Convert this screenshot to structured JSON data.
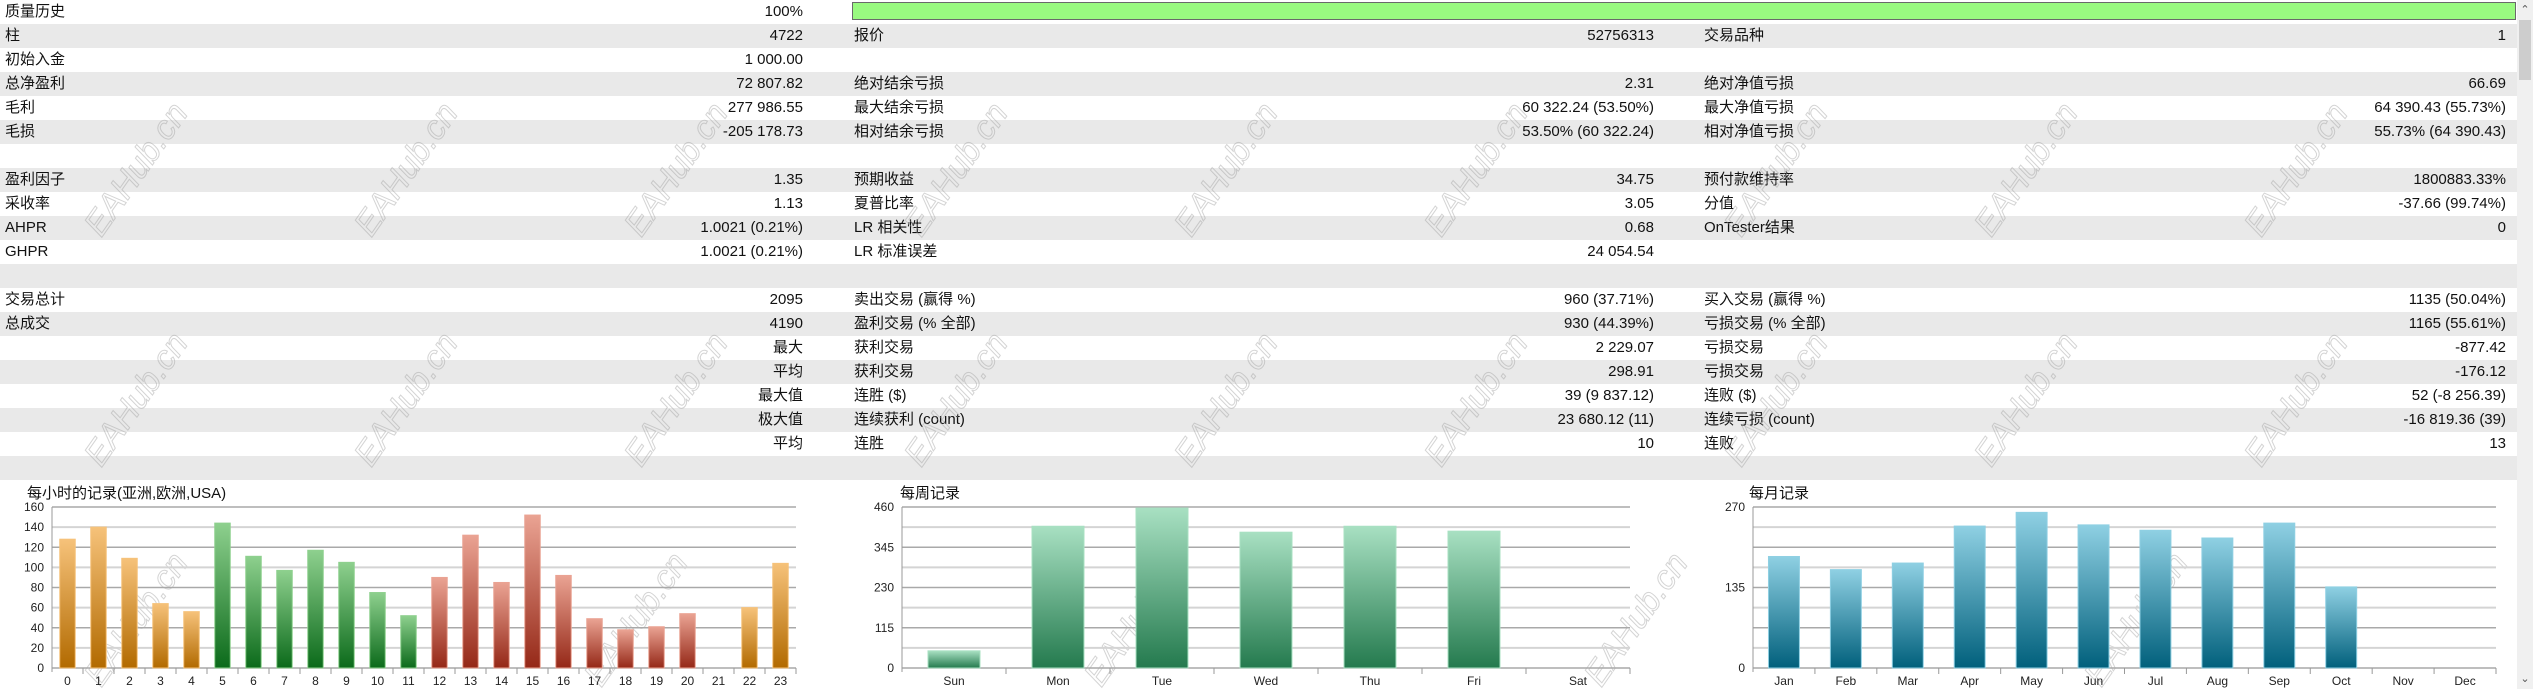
{
  "quality": {
    "label": "质量历史",
    "value": "100%",
    "fill": 1.0,
    "bar_color": "#99fa80"
  },
  "rows": [
    {
      "c1": [
        "柱",
        "4722"
      ],
      "c2": [
        "报价",
        "52756313"
      ],
      "c3": [
        "交易品种",
        "1"
      ]
    },
    {
      "c1": [
        "初始入金",
        "1 000.00"
      ],
      "c2": [
        "",
        ""
      ],
      "c3": [
        "",
        ""
      ]
    },
    {
      "c1": [
        "总净盈利",
        "72 807.82"
      ],
      "c2": [
        "绝对结余亏损",
        "2.31"
      ],
      "c3": [
        "绝对净值亏损",
        "66.69"
      ]
    },
    {
      "c1": [
        "毛利",
        "277 986.55"
      ],
      "c2": [
        "最大结余亏损",
        "60 322.24 (53.50%)"
      ],
      "c3": [
        "最大净值亏损",
        "64 390.43 (55.73%)"
      ]
    },
    {
      "c1": [
        "毛损",
        "-205 178.73"
      ],
      "c2": [
        "相对结余亏损",
        "53.50% (60 322.24)"
      ],
      "c3": [
        "相对净值亏损",
        "55.73% (64 390.43)"
      ]
    },
    {
      "c1": [
        "",
        ""
      ],
      "c2": [
        "",
        ""
      ],
      "c3": [
        "",
        ""
      ]
    },
    {
      "c1": [
        "盈利因子",
        "1.35"
      ],
      "c2": [
        "预期收益",
        "34.75"
      ],
      "c3": [
        "预付款维持率",
        "1800883.33%"
      ]
    },
    {
      "c1": [
        "采收率",
        "1.13"
      ],
      "c2": [
        "夏普比率",
        "3.05"
      ],
      "c3": [
        "分值",
        "-37.66 (99.74%)"
      ]
    },
    {
      "c1": [
        "AHPR",
        "1.0021 (0.21%)"
      ],
      "c2": [
        "LR 相关性",
        "0.68"
      ],
      "c3": [
        "OnTester结果",
        "0"
      ]
    },
    {
      "c1": [
        "GHPR",
        "1.0021 (0.21%)"
      ],
      "c2": [
        "LR 标准误差",
        "24 054.54"
      ],
      "c3": [
        "",
        ""
      ]
    },
    {
      "c1": [
        "",
        ""
      ],
      "c2": [
        "",
        ""
      ],
      "c3": [
        "",
        ""
      ]
    },
    {
      "c1": [
        "交易总计",
        "2095"
      ],
      "c2": [
        "卖出交易 (赢得 %)",
        "960 (37.71%)"
      ],
      "c3": [
        "买入交易 (赢得 %)",
        "1135 (50.04%)"
      ]
    },
    {
      "c1": [
        "总成交",
        "4190"
      ],
      "c2": [
        "盈利交易 (% 全部)",
        "930 (44.39%)"
      ],
      "c3": [
        "亏损交易 (% 全部)",
        "1165 (55.61%)"
      ]
    },
    {
      "c1": [
        "",
        "最大"
      ],
      "c2": [
        "获利交易",
        "2 229.07"
      ],
      "c3": [
        "亏损交易",
        "-877.42"
      ]
    },
    {
      "c1": [
        "",
        "平均"
      ],
      "c2": [
        "获利交易",
        "298.91"
      ],
      "c3": [
        "亏损交易",
        "-176.12"
      ]
    },
    {
      "c1": [
        "",
        "最大值"
      ],
      "c2": [
        "连胜 ($)",
        "39 (9 837.12)"
      ],
      "c3": [
        "连败 ($)",
        "52 (-8 256.39)"
      ]
    },
    {
      "c1": [
        "",
        "极大值"
      ],
      "c2": [
        "连续获利 (count)",
        "23 680.12 (11)"
      ],
      "c3": [
        "连续亏损 (count)",
        "-16 819.36 (39)"
      ]
    },
    {
      "c1": [
        "",
        "平均"
      ],
      "c2": [
        "连胜",
        "10"
      ],
      "c3": [
        "连败",
        "13"
      ]
    },
    {
      "c1": [
        "",
        ""
      ],
      "c2": [
        "",
        ""
      ],
      "c3": [
        "",
        ""
      ]
    }
  ],
  "watermark": "EAHub.cn",
  "scrollbar": {
    "up_icon": "chevron-up-icon",
    "down_icon": "chevron-down-icon"
  },
  "chart_data": [
    {
      "type": "bar",
      "title": "每小时的记录(亚洲,欧洲,USA)",
      "categories": [
        "0",
        "1",
        "2",
        "3",
        "4",
        "5",
        "6",
        "7",
        "8",
        "9",
        "10",
        "11",
        "12",
        "13",
        "14",
        "15",
        "16",
        "17",
        "18",
        "19",
        "20",
        "21",
        "22",
        "23"
      ],
      "values": [
        128,
        140,
        109,
        64,
        56,
        144,
        111,
        97,
        117,
        105,
        75,
        52,
        90,
        132,
        85,
        152,
        92,
        49,
        38,
        41,
        54,
        0,
        60,
        104
      ],
      "groups": [
        "asia",
        "asia",
        "asia",
        "asia",
        "asia",
        "europe",
        "europe",
        "europe",
        "europe",
        "europe",
        "europe",
        "europe",
        "usa",
        "usa",
        "usa",
        "usa",
        "usa",
        "usa",
        "usa",
        "usa",
        "usa",
        "usa",
        "asia",
        "asia"
      ],
      "group_colors": {
        "asia": [
          "#f6c27a",
          "#b26a00"
        ],
        "europe": [
          "#8ed08e",
          "#0b6a1a"
        ],
        "usa": [
          "#eaa393",
          "#952817"
        ]
      },
      "ylim": [
        0,
        160
      ],
      "yticks": [
        0,
        20,
        40,
        60,
        80,
        100,
        120,
        140,
        160
      ],
      "grid": true
    },
    {
      "type": "bar",
      "title": "每周记录",
      "categories": [
        "Sun",
        "Mon",
        "Tue",
        "Wed",
        "Thu",
        "Fri",
        "Sat"
      ],
      "values": [
        49,
        405,
        457,
        388,
        405,
        391,
        0
      ],
      "colors": [
        "#a8e0c2",
        "#247a4e"
      ],
      "ylim": [
        0,
        460
      ],
      "yticks": [
        0,
        115,
        230,
        345,
        460
      ],
      "grid": true
    },
    {
      "type": "bar",
      "title": "每月记录",
      "categories": [
        "Jan",
        "Feb",
        "Mar",
        "Apr",
        "May",
        "Jun",
        "Jul",
        "Aug",
        "Sep",
        "Oct",
        "Nov",
        "Dec"
      ],
      "values": [
        187,
        165,
        176,
        238,
        261,
        240,
        231,
        218,
        243,
        136,
        0,
        0
      ],
      "colors": [
        "#8fd0e3",
        "#01607c"
      ],
      "ylim": [
        0,
        270
      ],
      "yticks": [
        0,
        135,
        270
      ],
      "grid": true
    }
  ]
}
